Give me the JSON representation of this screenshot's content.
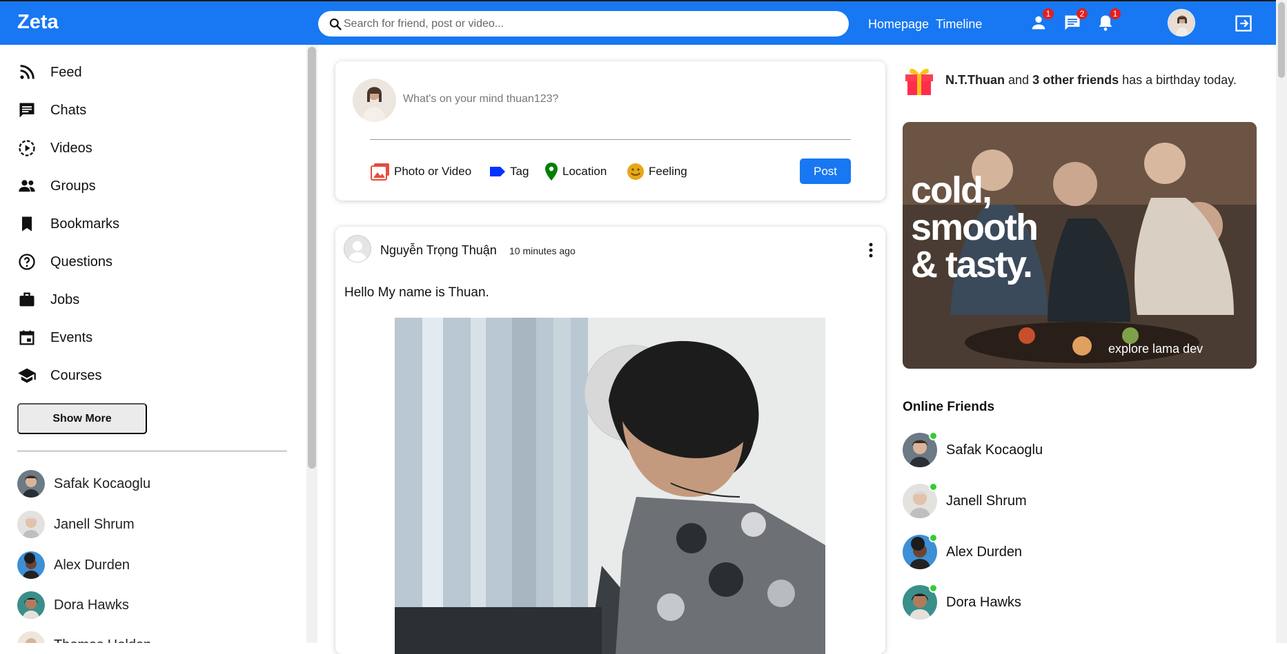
{
  "topbar": {
    "logo": "Zeta",
    "search_placeholder": "Search for friend, post or video...",
    "links": [
      "Homepage",
      "Timeline"
    ],
    "badges": {
      "friends": "1",
      "messages": "2",
      "notifications": "1"
    },
    "icons": [
      "person-icon",
      "chat-icon",
      "bell-icon",
      "logout-icon"
    ],
    "accent": "#1877f2"
  },
  "sidebar": {
    "items": [
      {
        "label": "Feed",
        "icon": "rss-icon"
      },
      {
        "label": "Chats",
        "icon": "chat-icon"
      },
      {
        "label": "Videos",
        "icon": "play-circle-icon"
      },
      {
        "label": "Groups",
        "icon": "group-icon"
      },
      {
        "label": "Bookmarks",
        "icon": "bookmark-icon"
      },
      {
        "label": "Questions",
        "icon": "help-circle-icon"
      },
      {
        "label": "Jobs",
        "icon": "briefcase-icon"
      },
      {
        "label": "Events",
        "icon": "calendar-icon"
      },
      {
        "label": "Courses",
        "icon": "school-icon"
      }
    ],
    "show_more": "Show More",
    "friends": [
      "Safak Kocaoglu",
      "Janell Shrum",
      "Alex Durden",
      "Dora Hawks",
      "Thomas Holden"
    ]
  },
  "share": {
    "placeholder": "What's on your mind thuan123?",
    "options": [
      {
        "label": "Photo or Video",
        "color": "#e74c3c"
      },
      {
        "label": "Tag",
        "color": "#0033ff"
      },
      {
        "label": "Location",
        "color": "#008000"
      },
      {
        "label": "Feeling",
        "color": "#e6a817"
      }
    ],
    "post_button": "Post"
  },
  "post": {
    "username": "Nguyễn Trọng Thuận",
    "time": "10 minutes ago",
    "text": "Hello My name is Thuan."
  },
  "rightbar": {
    "birthday_name": "N.T.Thuan",
    "birthday_and": "and",
    "birthday_others": "3 other friends",
    "birthday_suffix": "has a birthday today.",
    "ad_text": "cold, smooth & tasty.",
    "ad_footer": "explore lama dev",
    "online_title": "Online Friends",
    "online": [
      "Safak Kocaoglu",
      "Janell Shrum",
      "Alex Durden",
      "Dora Hawks"
    ],
    "online_color": "#32cd32"
  }
}
